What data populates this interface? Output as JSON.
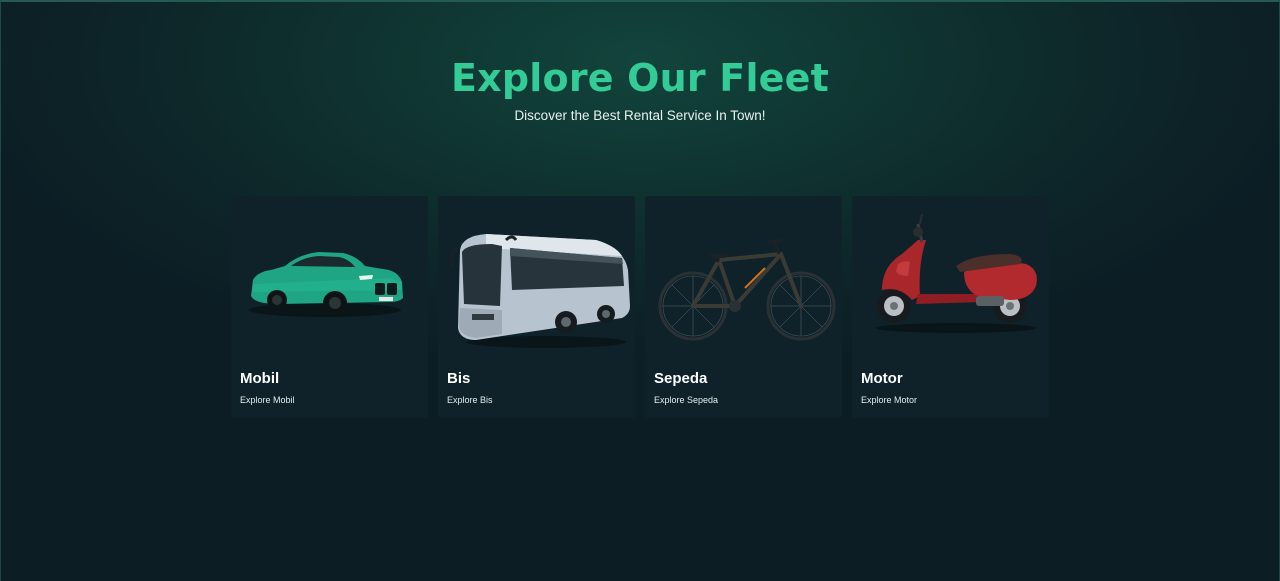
{
  "hero": {
    "title": "Explore Our Fleet",
    "subtitle": "Discover the Best Rental Service In Town!"
  },
  "fleet": [
    {
      "title": "Mobil",
      "link": "Explore Mobil",
      "icon": "car-image"
    },
    {
      "title": "Bis",
      "link": "Explore Bis",
      "icon": "bus-image"
    },
    {
      "title": "Sepeda",
      "link": "Explore Sepeda",
      "icon": "bicycle-image"
    },
    {
      "title": "Motor",
      "link": "Explore Motor",
      "icon": "scooter-image"
    }
  ],
  "colors": {
    "accent": "#33cc96",
    "card_bg": "#0f222a",
    "page_bg": "#0d2428"
  }
}
